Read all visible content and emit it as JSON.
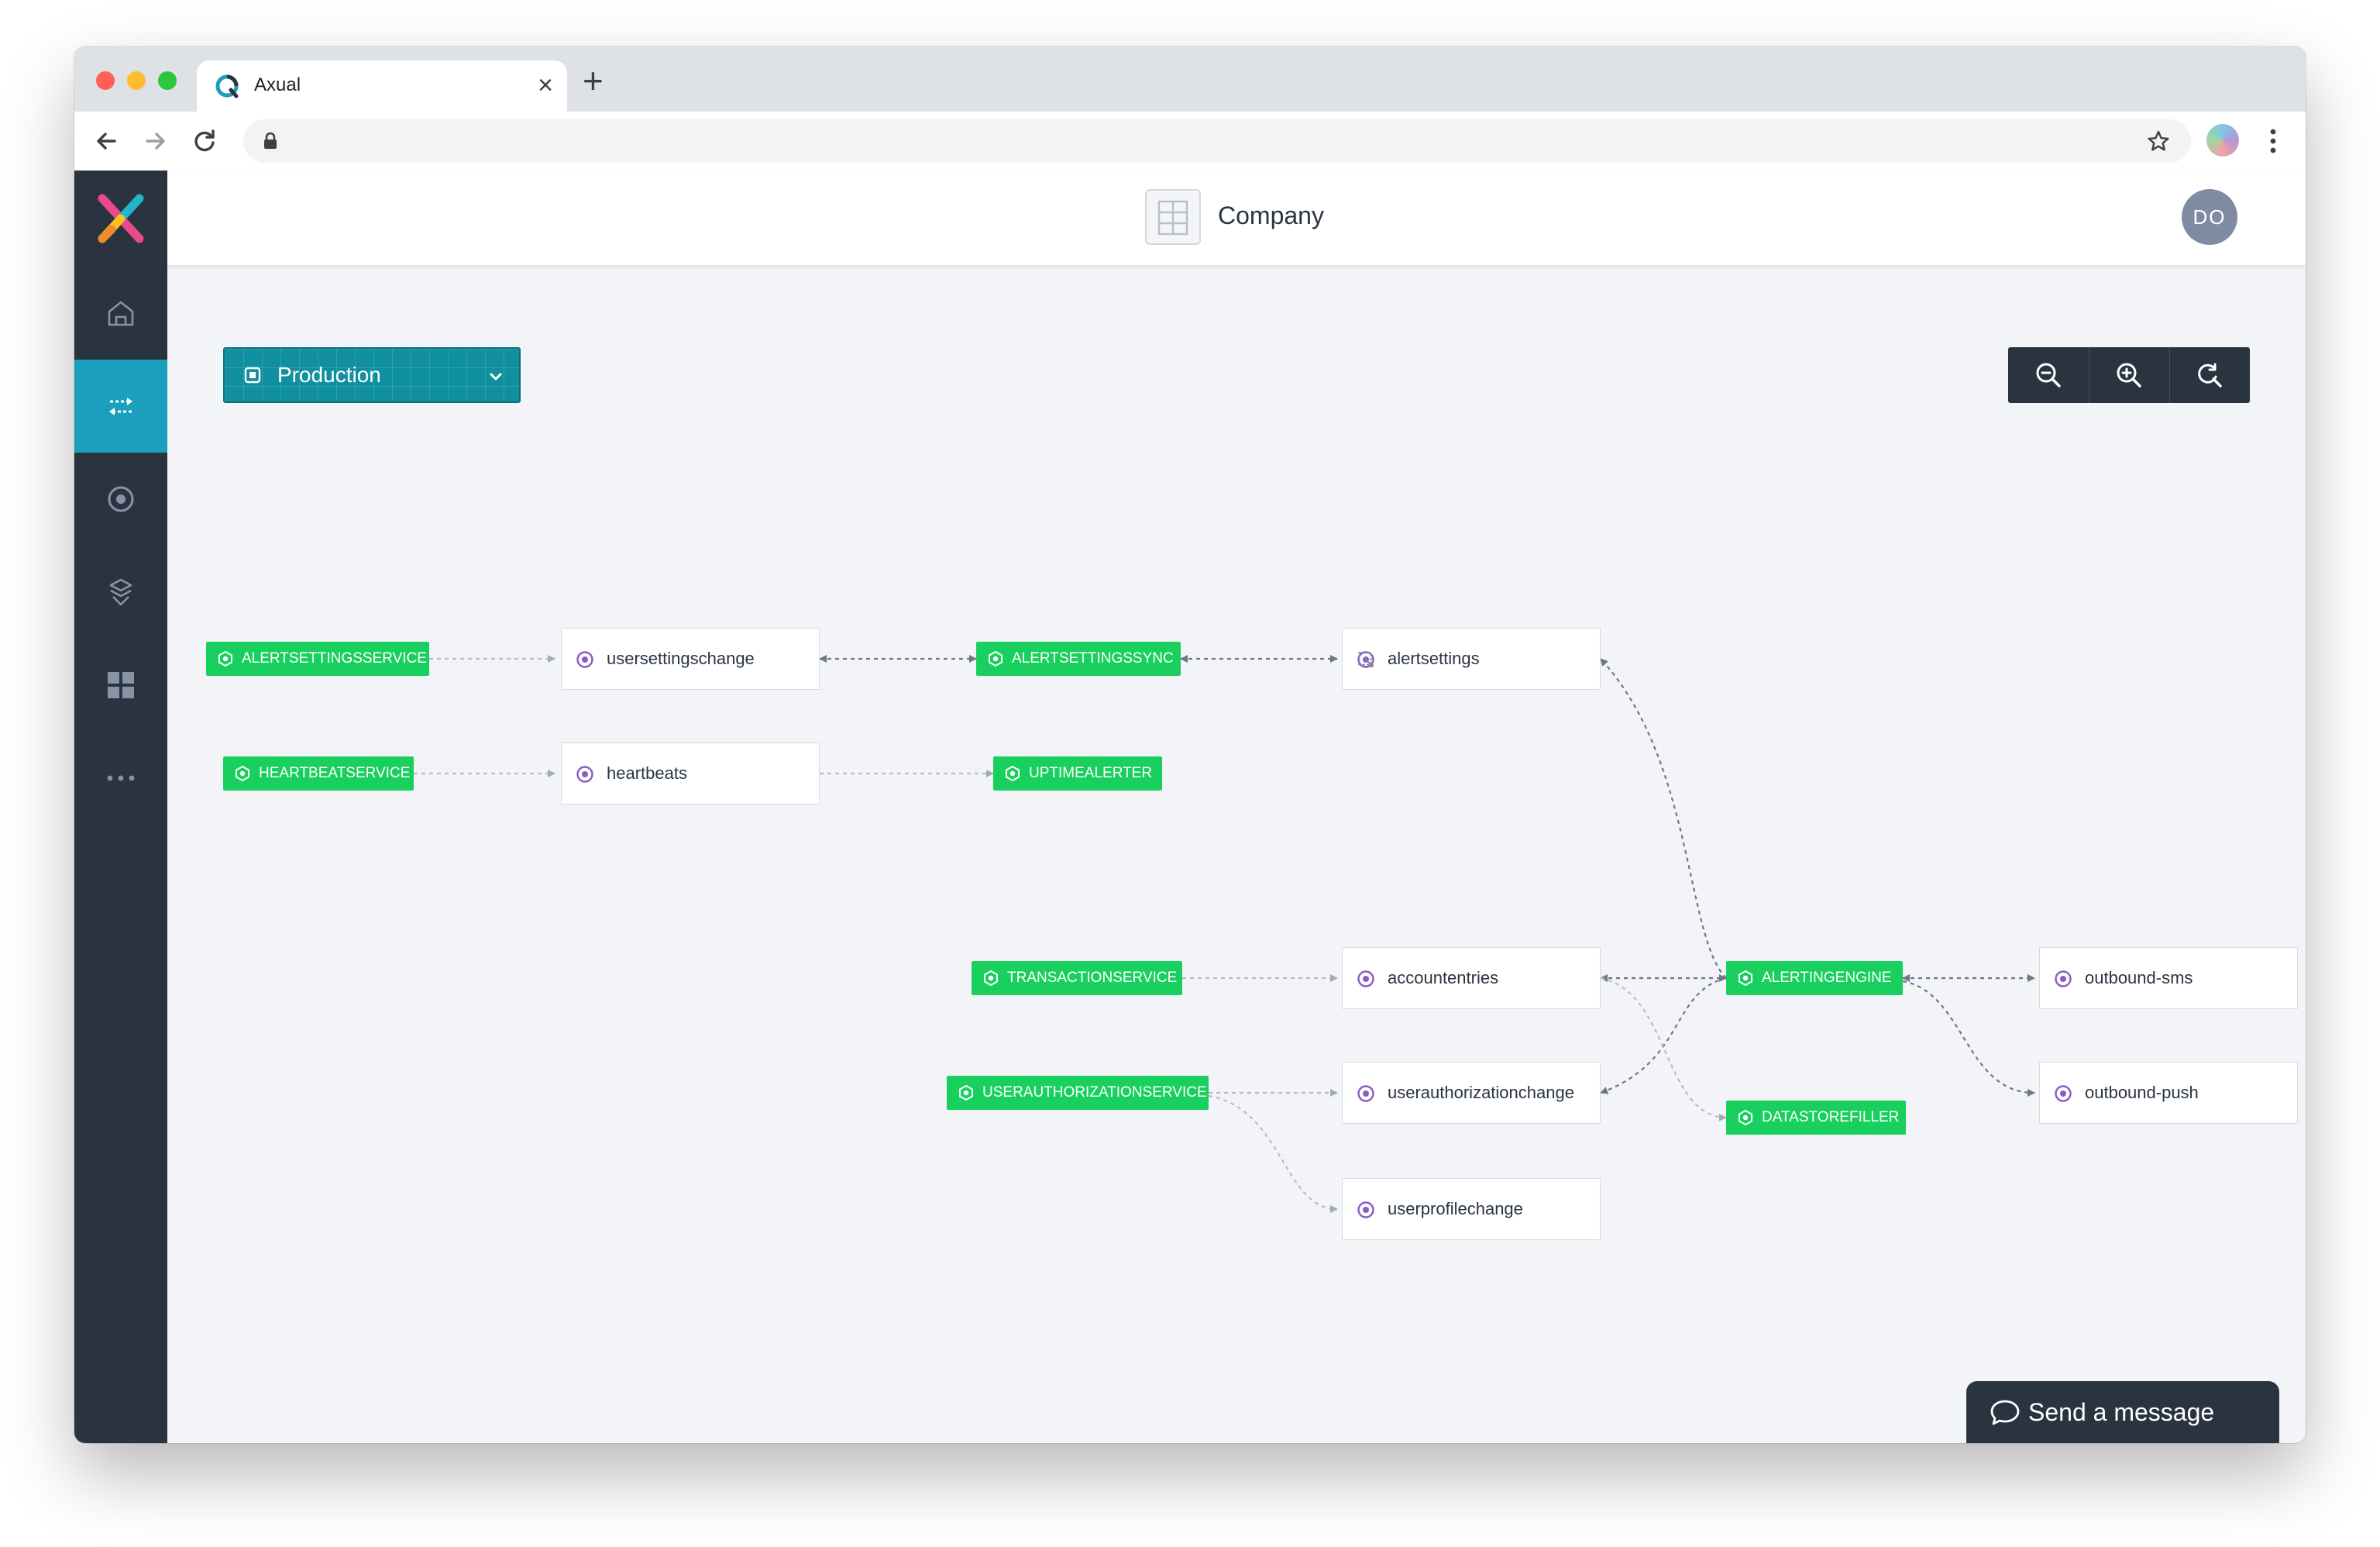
{
  "browser": {
    "tab_title": "Axual",
    "tab_close": "×",
    "new_tab": "+"
  },
  "header": {
    "company": "Company",
    "avatar_initials": "DO"
  },
  "sidebar": {
    "items": [
      {
        "icon": "home-icon"
      },
      {
        "icon": "streams-icon",
        "active": true
      },
      {
        "icon": "topic-icon"
      },
      {
        "icon": "applications-icon"
      },
      {
        "icon": "dashboard-icon"
      },
      {
        "icon": "more-icon"
      }
    ]
  },
  "environment": {
    "selected": "Production"
  },
  "zoom": {
    "buttons": [
      "zoom-out-icon",
      "zoom-in-icon",
      "reset-zoom-icon"
    ]
  },
  "graph": {
    "applications": [
      "ALERTSETTINGSSERVICE",
      "HEARTBEATSERVICE",
      "ALERTSETTINGSSYNC",
      "UPTIMEALERTER",
      "TRANSACTIONSERVICE",
      "USERAUTHORIZATIONSERVICE",
      "ALERTINGENGINE",
      "DATASTOREFILLER"
    ],
    "topics": [
      "usersettingschange",
      "heartbeats",
      "alertsettings",
      "accountentries",
      "userauthorizationchange",
      "userprofilechange",
      "outbound-sms",
      "outbound-push"
    ]
  },
  "chat": {
    "label": "Send a message"
  },
  "colors": {
    "sidebar": "#2a3441",
    "active": "#1a9fbd",
    "application": "#19d05f",
    "topic_icon": "#8a5cc6",
    "environment": "#10909e"
  }
}
